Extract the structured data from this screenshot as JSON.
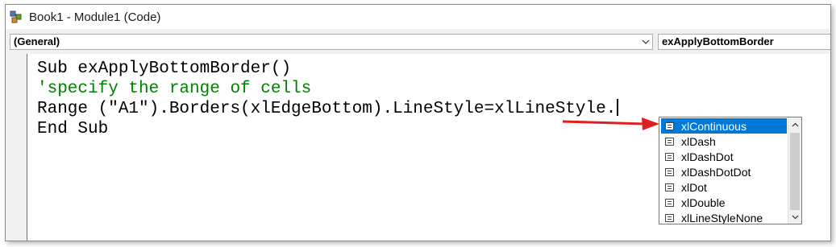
{
  "window": {
    "title": "Book1 - Module1 (Code)",
    "icon": "vba-module-icon"
  },
  "toolbar": {
    "object_combo": "(General)",
    "procedure_combo": "exApplyBottomBorder"
  },
  "code": {
    "lines": [
      "Sub exApplyBottomBorder()",
      "'specify the range of cells",
      "Range (\"A1\").Borders(xlEdgeBottom).LineStyle=xlLineStyle.",
      "End Sub"
    ]
  },
  "intellisense": {
    "items": [
      "xlContinuous",
      "xlDash",
      "xlDashDot",
      "xlDashDotDot",
      "xlDot",
      "xlDouble",
      "xlLineStyleNone"
    ],
    "selected_index": 0
  },
  "colors": {
    "comment": "#008000",
    "selection": "#0078d7",
    "annotation_arrow": "#e02020"
  }
}
